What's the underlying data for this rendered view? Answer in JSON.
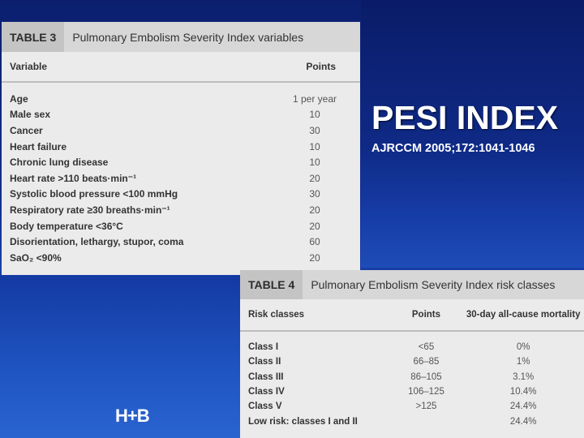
{
  "slide": {
    "title": "PESI INDEX",
    "subtitle": "AJRCCM 2005;172:1041-1046",
    "logo": "H+B"
  },
  "table3": {
    "label": "TABLE 3",
    "title": "Pulmonary Embolism Severity Index variables",
    "columns": [
      "Variable",
      "Points"
    ],
    "rows": [
      {
        "variable": "Age",
        "points": "1 per year"
      },
      {
        "variable": "Male sex",
        "points": "10"
      },
      {
        "variable": "Cancer",
        "points": "30"
      },
      {
        "variable": "Heart failure",
        "points": "10"
      },
      {
        "variable": "Chronic lung disease",
        "points": "10"
      },
      {
        "variable": "Heart rate >110 beats·min⁻¹",
        "points": "20"
      },
      {
        "variable": "Systolic blood pressure <100 mmHg",
        "points": "30"
      },
      {
        "variable": "Respiratory rate ≥30 breaths·min⁻¹",
        "points": "20"
      },
      {
        "variable": "Body temperature <36°C",
        "points": "20"
      },
      {
        "variable": "Disorientation, lethargy, stupor, coma",
        "points": "60"
      },
      {
        "variable": "SaO₂ <90%",
        "points": "20"
      }
    ]
  },
  "table4": {
    "label": "TABLE 4",
    "title": "Pulmonary Embolism Severity Index risk classes",
    "columns": [
      "Risk classes",
      "Points",
      "30-day all-cause mortality"
    ],
    "rows": [
      {
        "cls": "Class I",
        "points": "<65",
        "mortality": "0%"
      },
      {
        "cls": "Class II",
        "points": "66–85",
        "mortality": "1%"
      },
      {
        "cls": "Class III",
        "points": "86–105",
        "mortality": "3.1%"
      },
      {
        "cls": "Class IV",
        "points": "106–125",
        "mortality": "10.4%"
      },
      {
        "cls": "Class V",
        "points": ">125",
        "mortality": "24.4%"
      },
      {
        "cls": "Low risk: classes I and II",
        "points": "",
        "mortality": "24.4%"
      }
    ]
  }
}
